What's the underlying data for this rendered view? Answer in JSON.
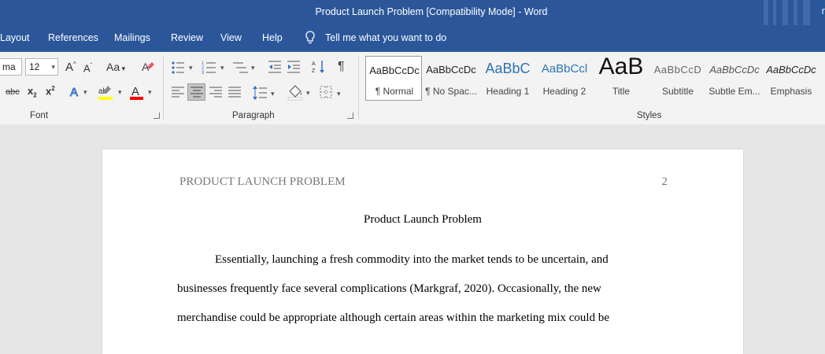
{
  "window": {
    "title": "Product Launch Problem [Compatibility Mode]  -  Word",
    "account_initial": "r"
  },
  "menu": {
    "items": [
      "Layout",
      "References",
      "Mailings",
      "Review",
      "View",
      "Help"
    ],
    "tell_me": "Tell me what you want to do"
  },
  "ribbon": {
    "font": {
      "name": "ma",
      "size": "12",
      "group_label": "Font",
      "change_case": "Aa",
      "grow_font": "A",
      "shrink_font": "A",
      "strikethrough": "abc",
      "subscript": "x",
      "superscript": "x"
    },
    "paragraph": {
      "group_label": "Paragraph",
      "show_marks": "¶"
    },
    "styles": {
      "group_label": "Styles",
      "items": [
        {
          "sample": "AaBbCcDc",
          "label": "¶ Normal"
        },
        {
          "sample": "AaBbCcDc",
          "label": "¶ No Spac..."
        },
        {
          "sample": "AaBbC",
          "label": "Heading 1"
        },
        {
          "sample": "AaBbCcl",
          "label": "Heading 2"
        },
        {
          "sample": "AaB",
          "label": "Title"
        },
        {
          "sample": "AaBbCcD",
          "label": "Subtitle"
        },
        {
          "sample": "AaBbCcDc",
          "label": "Subtle Em..."
        },
        {
          "sample": "AaBbCcDc",
          "label": "Emphasis"
        }
      ]
    },
    "colors": {
      "highlight": "#ffff00",
      "font_color": "#ff0000"
    }
  },
  "document": {
    "header": "PRODUCT LAUNCH PROBLEM",
    "page_number": "2",
    "title": "Product Launch Problem",
    "lines": [
      "Essentially, launching a fresh commodity into the market tends to be uncertain, and",
      "businesses frequently face several complications (Markgraf, 2020). Occasionally, the new",
      "merchandise could be appropriate although certain areas within the marketing mix could be"
    ]
  }
}
